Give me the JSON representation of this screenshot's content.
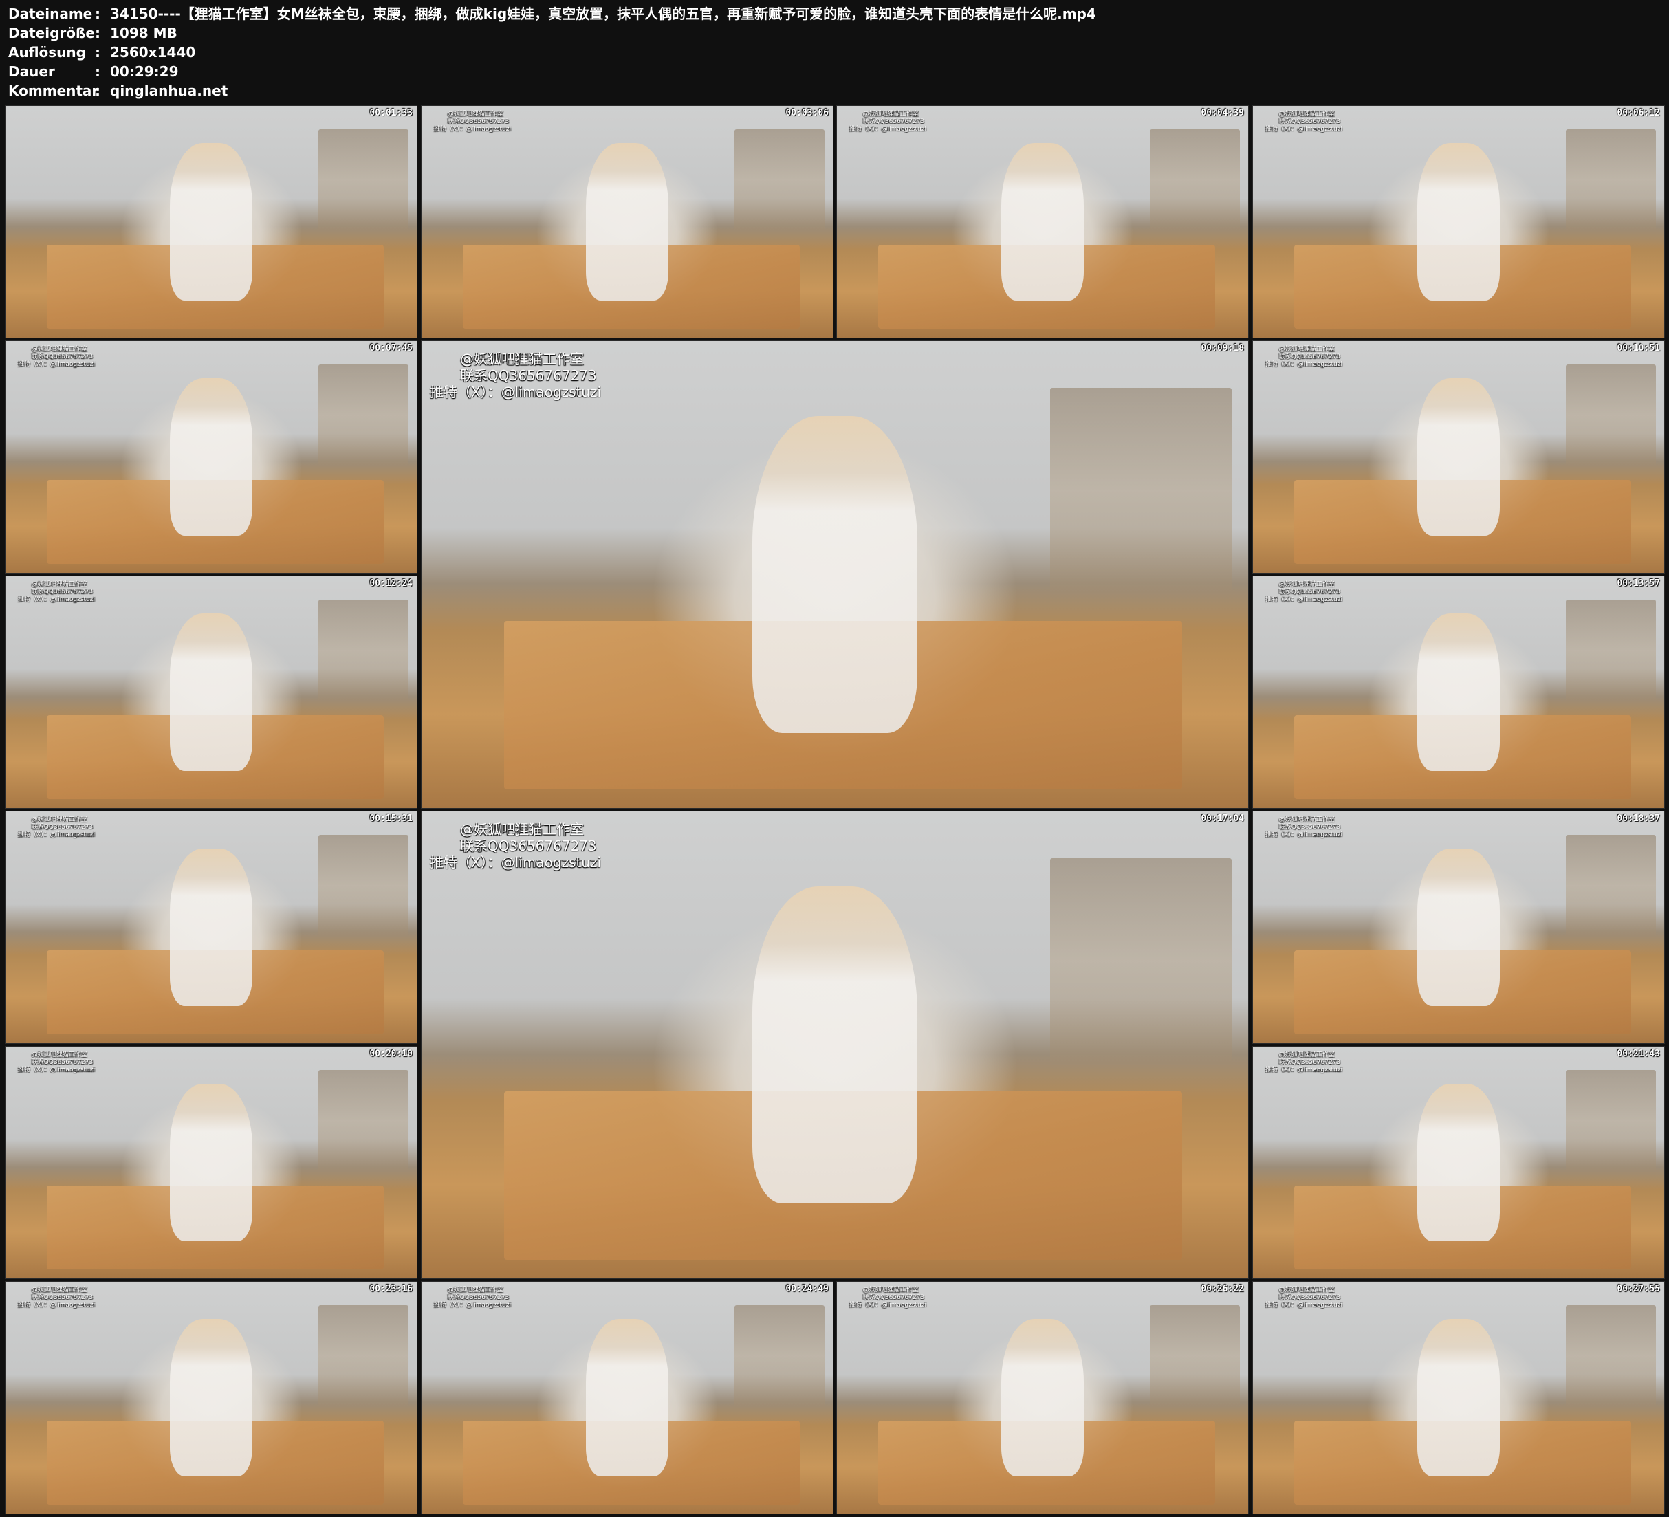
{
  "info": [
    {
      "key": "Dateiname",
      "sep": ":",
      "value": "34150----【狸猫工作室】女M丝袜全包，束腰，捆绑，做成kig娃娃，真空放置，抹平人偶的五官，再重新赋予可爱的脸，谁知道头壳下面的表情是什么呢.mp4"
    },
    {
      "key": "Dateigröße",
      "sep": ":",
      "value": "1098 MB"
    },
    {
      "key": "Auflösung",
      "sep": ":",
      "value": "2560x1440"
    },
    {
      "key": "Dauer",
      "sep": ":",
      "value": "00:29:29"
    },
    {
      "key": "Kommentar",
      "sep": ":",
      "value": "qinglanhua.net"
    }
  ],
  "watermark": {
    "line1": "@妖狐吧狸猫工作室",
    "line2": "联系QQ3656767273",
    "line3": "推特（X）：@limaogzstuzi"
  },
  "thumbnails": [
    {
      "time": "00:01:33",
      "watermark": false
    },
    {
      "time": "00:03:06",
      "watermark": true
    },
    {
      "time": "00:04:39",
      "watermark": true
    },
    {
      "time": "00:06:12",
      "watermark": true
    },
    {
      "time": "00:07:45",
      "watermark": true
    },
    {
      "time": "00:09:18",
      "watermark": true,
      "large": true
    },
    {
      "time": "00:10:51",
      "watermark": true
    },
    {
      "time": "00:12:24",
      "watermark": true
    },
    {
      "time": "00:13:57",
      "watermark": true
    },
    {
      "time": "00:15:31",
      "watermark": true
    },
    {
      "time": "00:17:04",
      "watermark": true,
      "large": true
    },
    {
      "time": "00:18:37",
      "watermark": true
    },
    {
      "time": "00:20:10",
      "watermark": true
    },
    {
      "time": "00:21:43",
      "watermark": true
    },
    {
      "time": "00:23:16",
      "watermark": true
    },
    {
      "time": "00:24:49",
      "watermark": true
    },
    {
      "time": "00:26:22",
      "watermark": true
    },
    {
      "time": "00:27:55",
      "watermark": true
    }
  ]
}
